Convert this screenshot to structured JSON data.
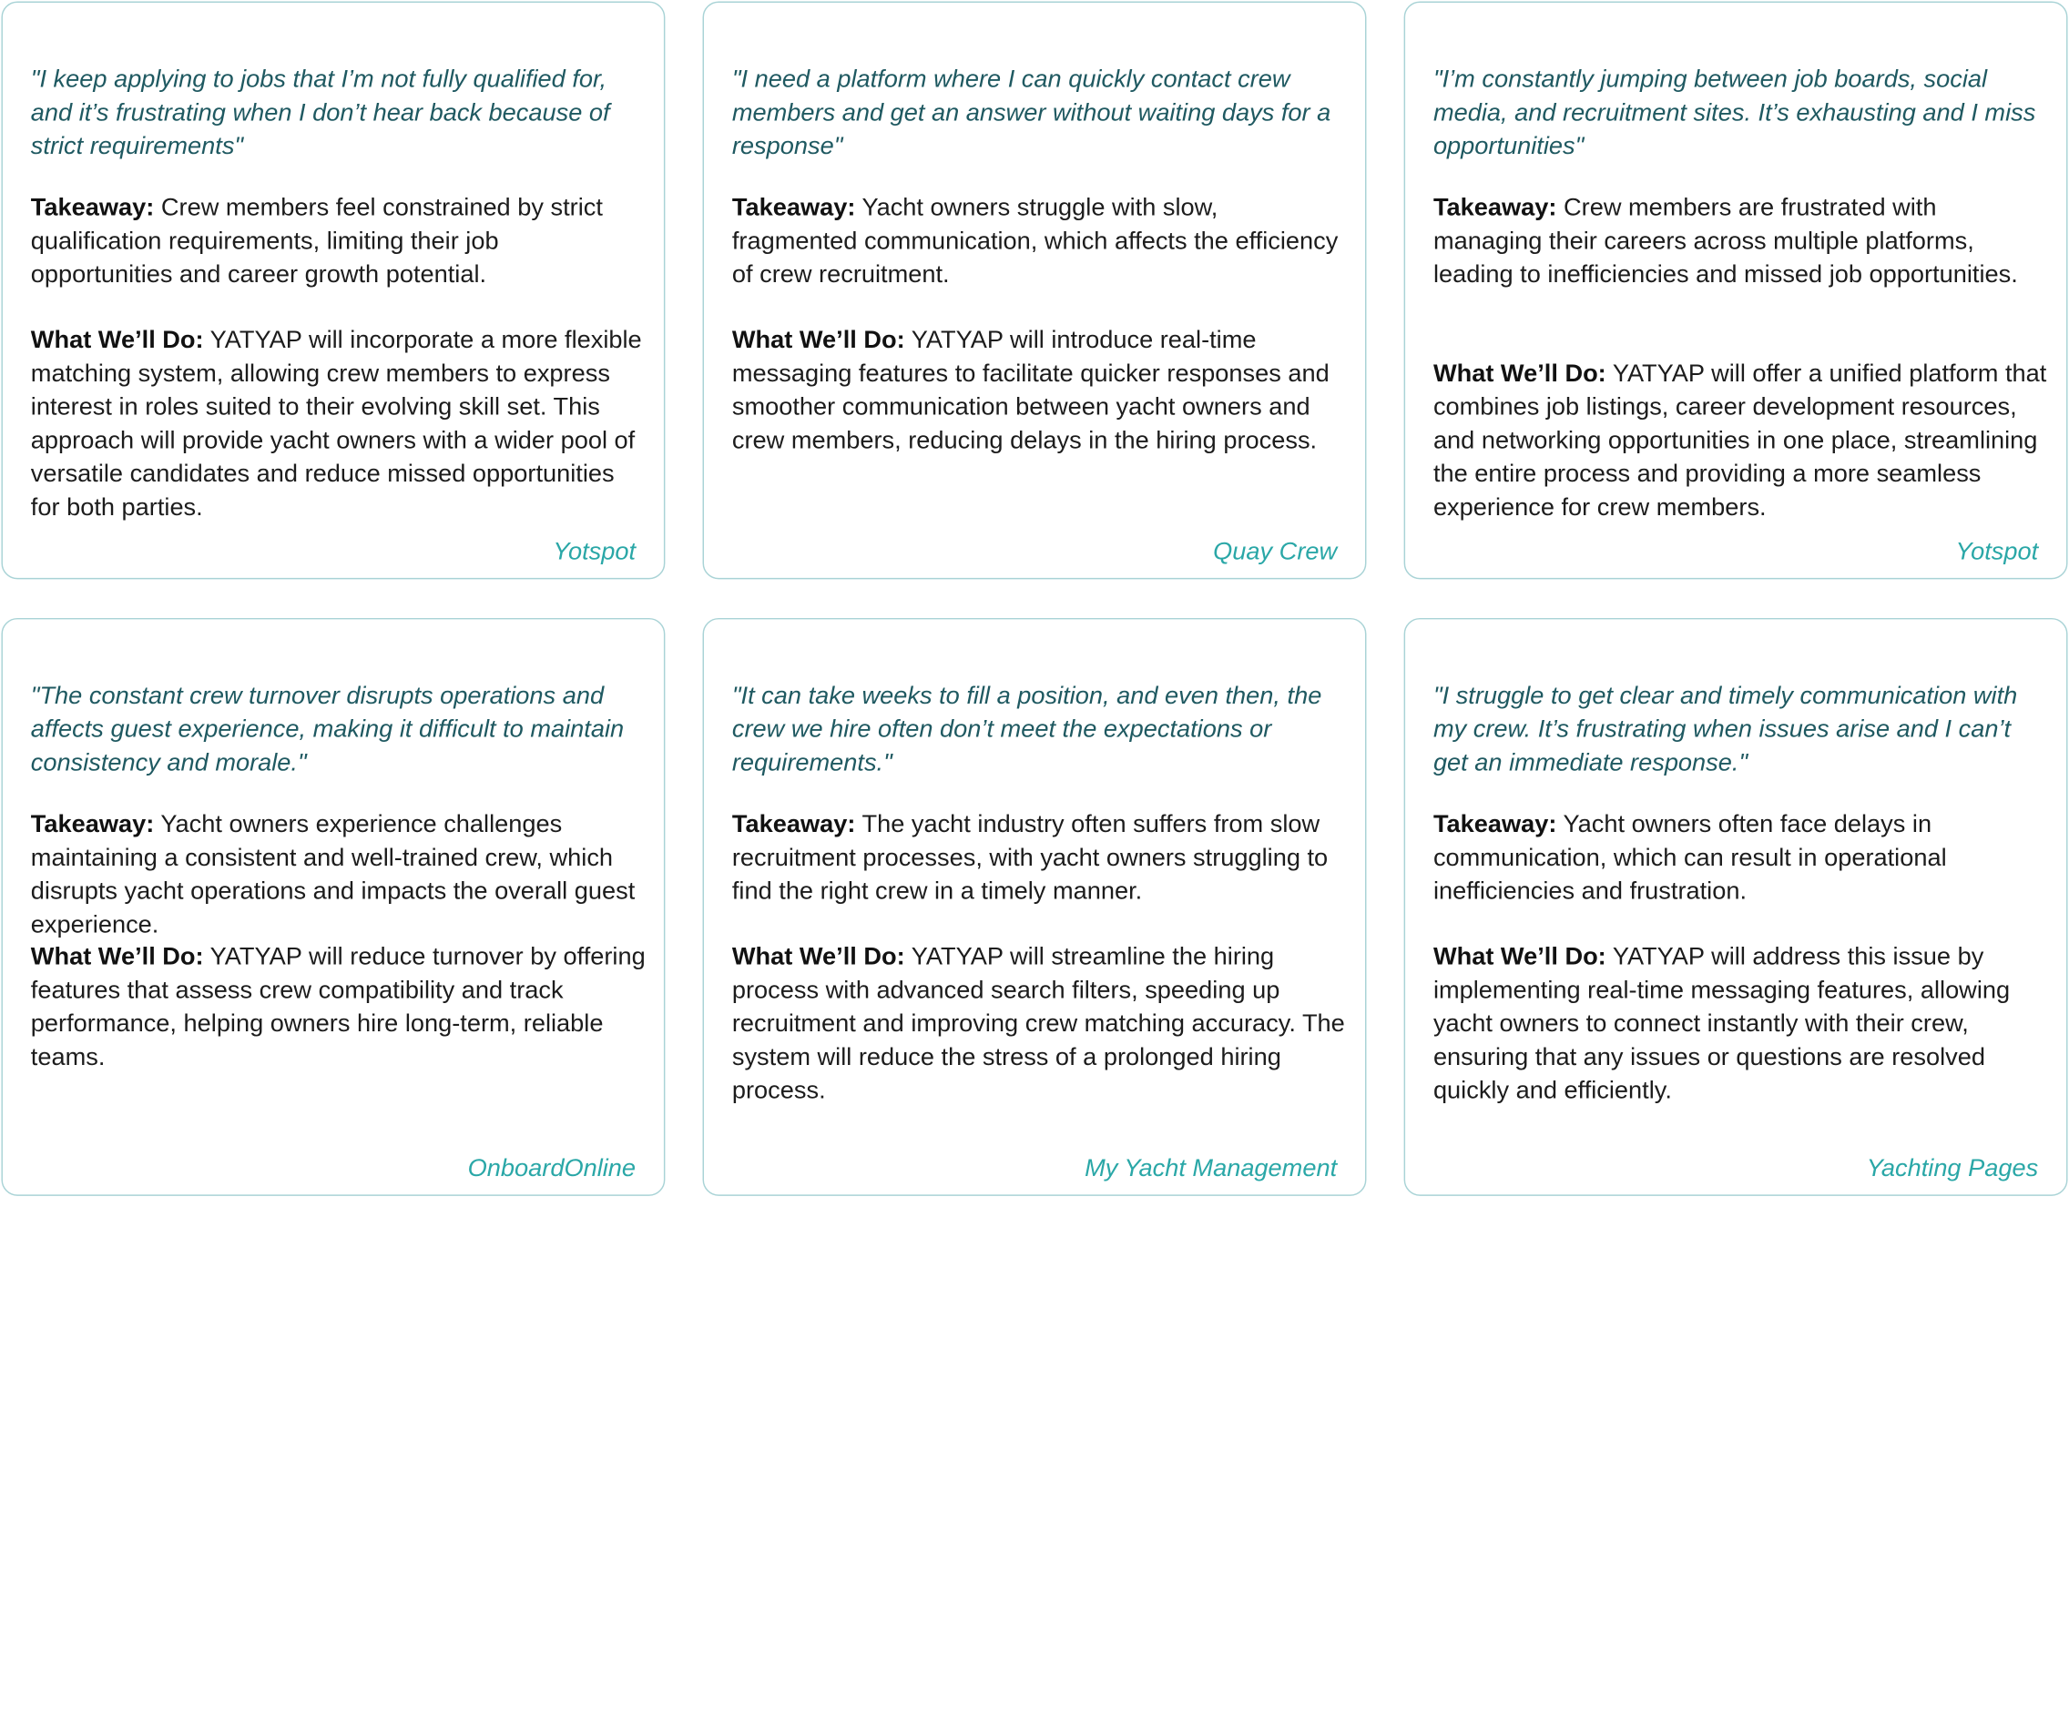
{
  "labels": {
    "takeaway": "Takeaway:",
    "what_we_do": "What We’ll Do:"
  },
  "colors": {
    "quote_text": "#1f5961",
    "source_text": "#2aa7a7",
    "card_border": "#a9d3d6",
    "body_text": "#1c1c1c"
  },
  "cards": [
    {
      "quote": "\"I keep applying to jobs that I’m not fully qualified for, and it’s frustrating when I don’t hear back because of strict requirements\"",
      "takeaway": "Crew members feel constrained by strict qualification requirements, limiting their job opportunities and career growth potential.",
      "action": "YATYAP will incorporate a more flexible matching system, allowing crew members to express interest in roles suited to their evolving skill set. This approach will provide yacht owners with a wider pool of versatile candidates and reduce missed opportunities for both parties.",
      "source": "Yotspot"
    },
    {
      "quote": "\"I need a platform where I can quickly contact crew members and get an answer without waiting days for a response\"",
      "takeaway": "Yacht owners struggle with slow, fragmented communication, which affects the efficiency of crew recruitment.",
      "action": "YATYAP will introduce real-time messaging features to facilitate quicker responses and smoother communication between yacht owners and crew members, reducing delays in the hiring process.",
      "source": "Quay Crew"
    },
    {
      "quote": "\"I’m constantly jumping between job boards, social media, and recruitment sites. It’s exhausting and I miss opportunities\"",
      "takeaway": "Crew members are frustrated with managing their careers across multiple platforms, leading to inefficiencies and missed job opportunities.",
      "action": "YATYAP will offer a unified platform that combines job listings, career development resources, and networking opportunities in one place, streamlining the entire process and providing a more seamless experience for crew members.",
      "source": "Yotspot"
    },
    {
      "quote": "\"The constant crew turnover disrupts operations and affects guest experience, making it difficult to maintain consistency and morale.\"",
      "takeaway": "Yacht owners experience challenges maintaining a consistent and well-trained crew, which disrupts yacht operations and impacts the overall guest experience.",
      "action": "YATYAP will reduce turnover by offering features that assess crew compatibility and track performance, helping owners hire long-term, reliable teams.",
      "source": "OnboardOnline"
    },
    {
      "quote": "\"It can take weeks to fill a position, and even then, the crew we hire often don’t meet the expectations or requirements.\"",
      "takeaway": "The yacht industry often suffers from slow recruitment processes, with yacht owners struggling to find the right crew in a timely manner.",
      "action": "YATYAP will streamline the hiring process with advanced search filters, speeding up recruitment and improving crew matching accuracy. The system will reduce the stress of a prolonged hiring process.",
      "source": "My Yacht Management"
    },
    {
      "quote": "\"I struggle to get clear and timely communication with my crew. It’s frustrating when issues arise and I can’t get an immediate response.\"",
      "takeaway": "Yacht owners often face delays in communication, which can result in operational inefficiencies and frustration.",
      "action": "YATYAP will address this issue by implementing real-time messaging features, allowing yacht owners to connect instantly with their crew, ensuring that any issues or questions are resolved quickly and efficiently.",
      "source": "Yachting Pages"
    }
  ]
}
